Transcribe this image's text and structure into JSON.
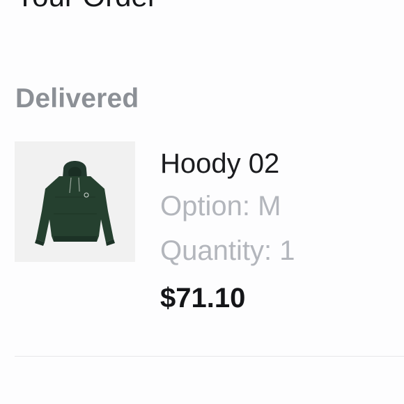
{
  "header": {
    "title": "Your Order"
  },
  "order_group": {
    "status_heading": "Delivered",
    "items": [
      {
        "name": "Hoody 02",
        "option_label": "Option:",
        "option_value": "M",
        "quantity_label": "Quantity:",
        "quantity_value": "1",
        "price": "$71.10",
        "image_icon": "green-hoodie-product-image",
        "image_color": "#22392e"
      }
    ]
  },
  "colors": {
    "heading_gray": "#8c9096",
    "secondary_text": "#b3b6bc",
    "primary_text": "#1b1c1f",
    "thumb_background": "#f1f1f1"
  }
}
